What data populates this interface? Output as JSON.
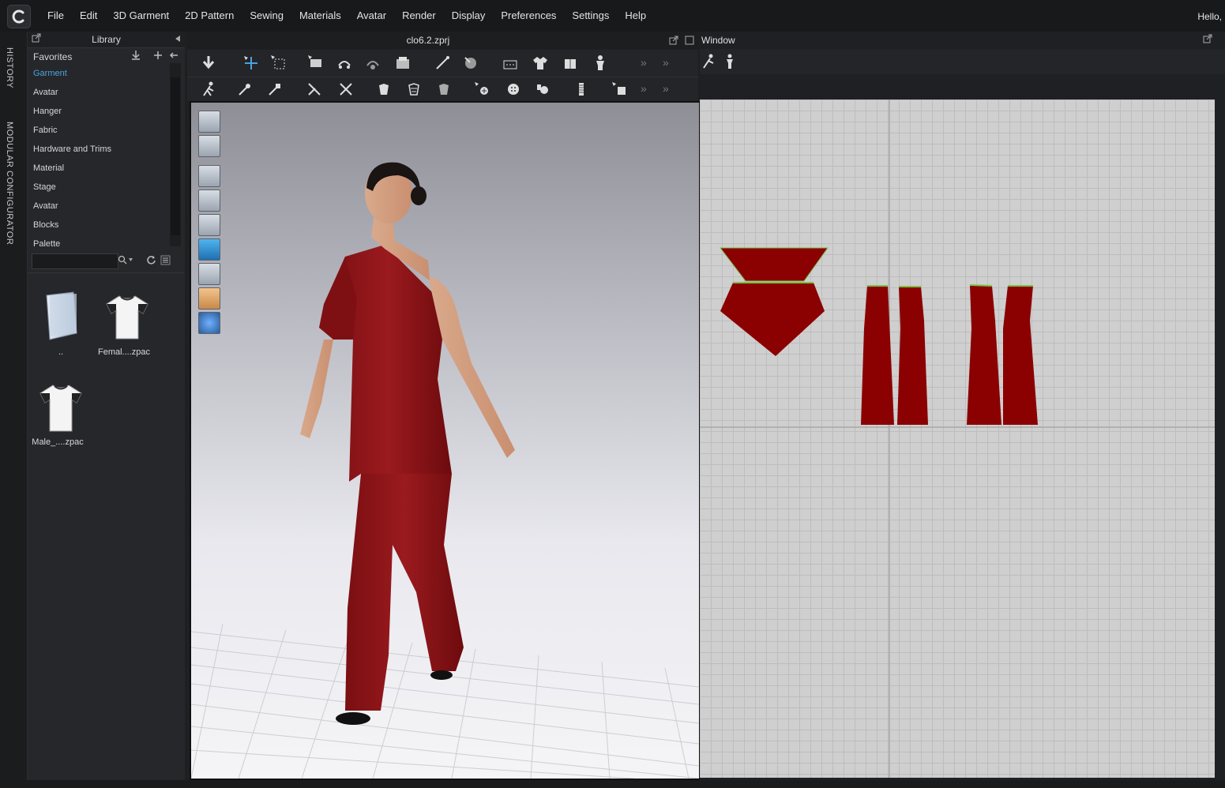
{
  "menubar": {
    "items": [
      "File",
      "Edit",
      "3D Garment",
      "2D Pattern",
      "Sewing",
      "Materials",
      "Avatar",
      "Render",
      "Display",
      "Preferences",
      "Settings",
      "Help"
    ],
    "greeting": "Hello,"
  },
  "vertical_tabs": [
    "HISTORY",
    "MODULAR CONFIGURATOR"
  ],
  "library": {
    "title": "Library",
    "categories": [
      "Favorites",
      "Garment",
      "Avatar",
      "Hanger",
      "Fabric",
      "Hardware and Trims",
      "Material",
      "Stage",
      "Avatar",
      "Blocks",
      "Palette"
    ],
    "selected_category": "Garment",
    "search_placeholder": "",
    "files": [
      {
        "label": "..",
        "icon": "folder-icon"
      },
      {
        "label": "Femal....zpac",
        "icon": "tshirt-icon"
      },
      {
        "label": "Male_....zpac",
        "icon": "tshirt-icon"
      }
    ]
  },
  "window_3d": {
    "title": "clo6.2.zprj"
  },
  "window_2d": {
    "title": "Window"
  },
  "colors": {
    "garment": "#8b0000",
    "accent": "#4aa3df",
    "seam": "#7cc04a"
  }
}
